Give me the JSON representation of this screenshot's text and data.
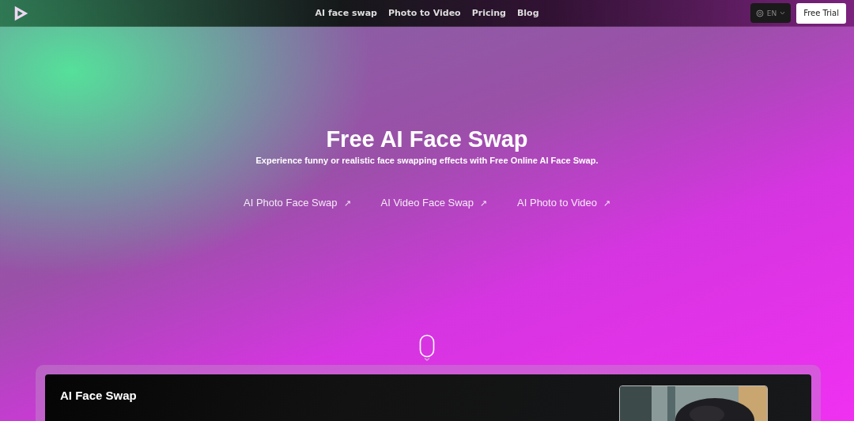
{
  "nav": {
    "links": [
      "AI face swap",
      "Photo to Video",
      "Pricing",
      "Blog"
    ],
    "language": "EN",
    "trial_button": "Free Trial"
  },
  "hero": {
    "title": "Free AI Face Swap",
    "subtitle": "Experience funny or realistic face swapping effects with Free Online AI Face Swap.",
    "links": [
      {
        "label": "AI Photo Face Swap",
        "icon": "↗"
      },
      {
        "label": "AI Video Face Swap",
        "icon": "↗"
      },
      {
        "label": "AI Photo to Video",
        "icon": "↗"
      }
    ]
  },
  "panel": {
    "title": "AI Face Swap"
  }
}
